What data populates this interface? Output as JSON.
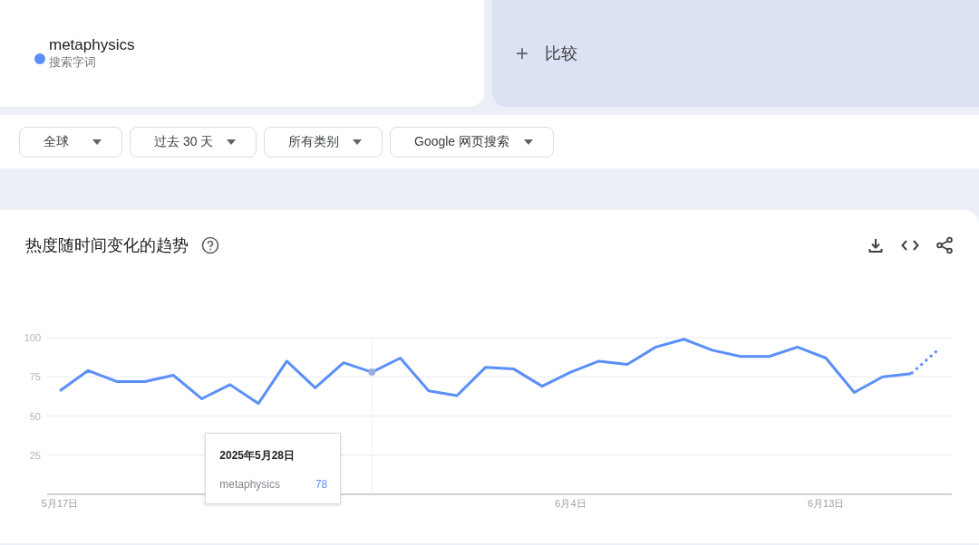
{
  "search_term": {
    "term": "metaphysics",
    "label": "搜索字词",
    "color": "#5b8ff9"
  },
  "compare": {
    "icon": "+",
    "label": "比较"
  },
  "filters": [
    {
      "label": "全球"
    },
    {
      "label": "过去 30 天"
    },
    {
      "label": "所有类别"
    },
    {
      "label": "Google 网页搜索"
    }
  ],
  "chart_card": {
    "title": "热度随时间变化的趋势",
    "chart_data": {
      "type": "line",
      "categories": [
        "5月17日",
        null,
        null,
        null,
        null,
        null,
        null,
        null,
        null,
        null,
        null,
        null,
        null,
        null,
        null,
        null,
        null,
        null,
        "6月4日",
        null,
        null,
        null,
        null,
        null,
        null,
        null,
        null,
        "6月13日",
        null,
        null,
        null,
        null
      ],
      "series": [
        {
          "name": "metaphysics",
          "color": "#5b8ff9",
          "values": [
            66,
            79,
            72,
            72,
            76,
            61,
            70,
            58,
            85,
            68,
            84,
            78,
            87,
            66,
            63,
            81,
            80,
            69,
            78,
            85,
            83,
            94,
            99,
            92,
            88,
            88,
            94,
            87,
            65,
            75,
            77,
            93
          ]
        }
      ],
      "ylim": [
        0,
        100
      ],
      "yticks": [
        25,
        50,
        75,
        100
      ],
      "grid": true
    },
    "tooltip": {
      "date": "2025年5月28日",
      "value": "78"
    }
  }
}
